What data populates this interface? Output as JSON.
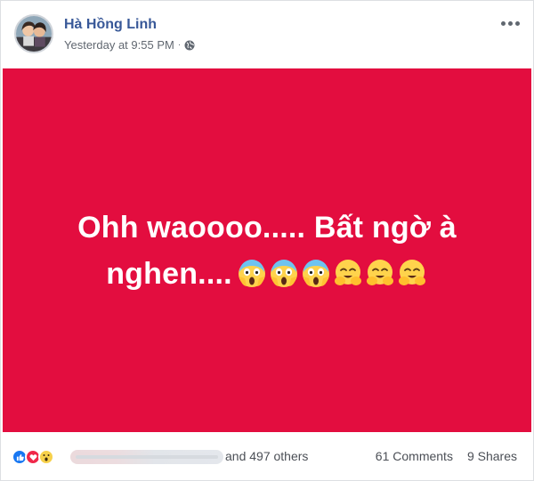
{
  "post": {
    "author": "Hà Hồng Linh",
    "timestamp": "Yesterday at 9:55 PM",
    "separator": "·",
    "privacy_icon": "globe-icon",
    "status_text": "Ohh waoooo..... Bất ngờ à nghen....",
    "status_bg_color": "#e30d3f",
    "emojis": [
      "face-screaming-in-fear",
      "face-screaming-in-fear",
      "face-screaming-in-fear",
      "hugging-face",
      "hugging-face",
      "hugging-face"
    ]
  },
  "footer": {
    "reaction_icons": [
      "like-icon",
      "love-icon",
      "wow-icon"
    ],
    "others_text": "and 497 others",
    "comments": "61 Comments",
    "shares": "9 Shares"
  },
  "colors": {
    "author_link": "#385898",
    "meta_text": "#606770",
    "like": "#1877f2",
    "love": "#f0284a",
    "wow": "#f7d14b"
  }
}
